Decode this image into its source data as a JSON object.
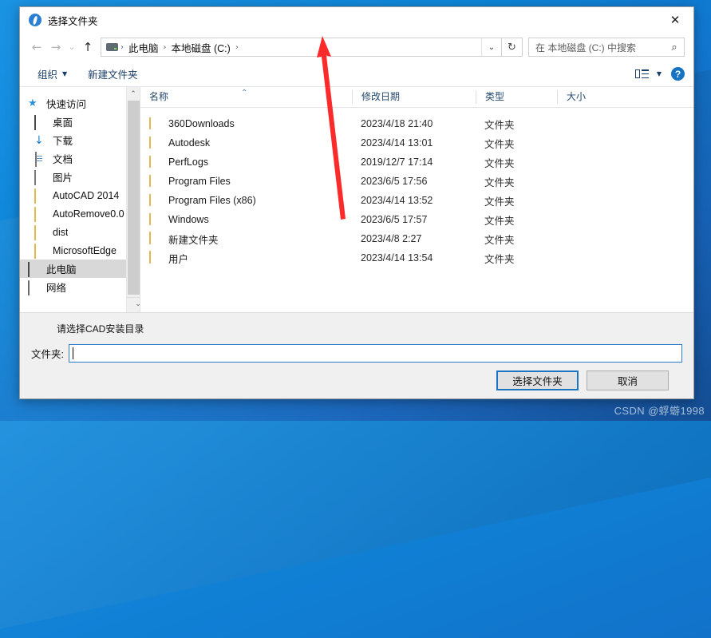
{
  "window": {
    "title": "选择文件夹",
    "app_icon": "app-circle-icon",
    "close_label": "✕"
  },
  "navigation": {
    "back": "←",
    "forward": "→",
    "recent": "⌄",
    "up": "↑",
    "refresh": "↻",
    "dropdown": "⌄",
    "breadcrumb": [
      {
        "label": "此电脑"
      },
      {
        "label": "本地磁盘 (C:)"
      }
    ],
    "separator": "›"
  },
  "search": {
    "placeholder": "在 本地磁盘 (C:) 中搜索",
    "icon": "search-icon"
  },
  "command_bar": {
    "organize": "组织",
    "organize_caret": "▼",
    "new_folder": "新建文件夹",
    "view_caret": "▼",
    "help": "?"
  },
  "sidebar": {
    "items": [
      {
        "label": "快速访问",
        "icon": "star-icon",
        "pinned": false,
        "selected": false,
        "root": true
      },
      {
        "label": "桌面",
        "icon": "monitor-icon",
        "pinned": true,
        "selected": false,
        "root": false
      },
      {
        "label": "下载",
        "icon": "download-icon",
        "pinned": true,
        "selected": false,
        "root": false
      },
      {
        "label": "文档",
        "icon": "document-icon",
        "pinned": true,
        "selected": false,
        "root": false
      },
      {
        "label": "图片",
        "icon": "picture-icon",
        "pinned": true,
        "selected": false,
        "root": false
      },
      {
        "label": "AutoCAD 2014",
        "icon": "folder-icon",
        "pinned": false,
        "selected": false,
        "root": false
      },
      {
        "label": "AutoRemove0.0",
        "icon": "folder-icon",
        "pinned": false,
        "selected": false,
        "root": false
      },
      {
        "label": "dist",
        "icon": "folder-icon",
        "pinned": false,
        "selected": false,
        "root": false
      },
      {
        "label": "MicrosoftEdge",
        "icon": "folder-icon",
        "pinned": false,
        "selected": false,
        "root": false
      },
      {
        "label": "此电脑",
        "icon": "monitor-icon",
        "pinned": false,
        "selected": true,
        "root": true
      },
      {
        "label": "网络",
        "icon": "network-icon",
        "pinned": false,
        "selected": false,
        "root": true
      }
    ],
    "pin_glyph": "📌",
    "scroll_up": "⌃",
    "scroll_down": "⌄"
  },
  "file_list": {
    "columns": [
      "名称",
      "修改日期",
      "类型",
      "大小"
    ],
    "sort_indicator": "⌃",
    "rows": [
      {
        "name": "360Downloads",
        "date": "2023/4/18 21:40",
        "type": "文件夹",
        "size": ""
      },
      {
        "name": "Autodesk",
        "date": "2023/4/14 13:01",
        "type": "文件夹",
        "size": ""
      },
      {
        "name": "PerfLogs",
        "date": "2019/12/7 17:14",
        "type": "文件夹",
        "size": ""
      },
      {
        "name": "Program Files",
        "date": "2023/6/5 17:56",
        "type": "文件夹",
        "size": ""
      },
      {
        "name": "Program Files (x86)",
        "date": "2023/4/14 13:52",
        "type": "文件夹",
        "size": ""
      },
      {
        "name": "Windows",
        "date": "2023/6/5 17:57",
        "type": "文件夹",
        "size": ""
      },
      {
        "name": "新建文件夹",
        "date": "2023/4/8 2:27",
        "type": "文件夹",
        "size": ""
      },
      {
        "name": "用户",
        "date": "2023/4/14 13:54",
        "type": "文件夹",
        "size": ""
      }
    ]
  },
  "bottom": {
    "prompt": "请选择CAD安装目录",
    "folder_label": "文件夹:",
    "folder_value": "",
    "select_button": "选择文件夹",
    "cancel_button": "取消"
  },
  "annotation": {
    "arrow_color": "#fb2b2b"
  },
  "watermark": "CSDN @蜉蝣1998"
}
